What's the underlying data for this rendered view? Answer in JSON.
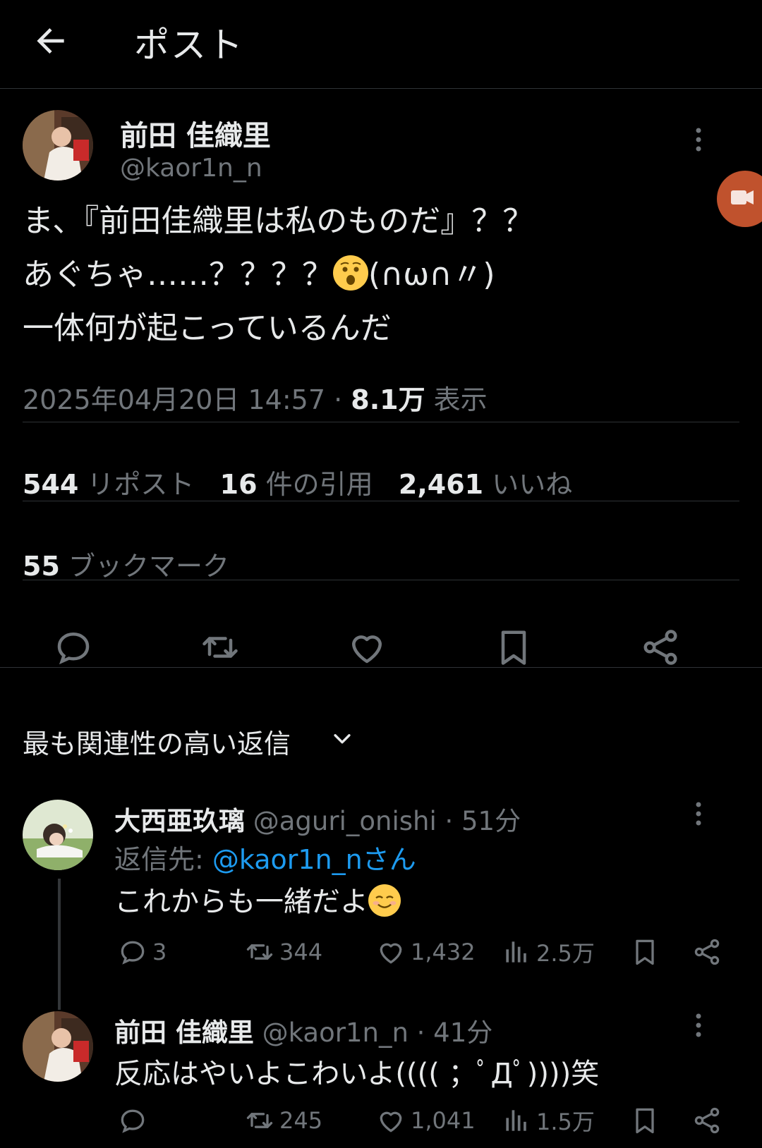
{
  "header": {
    "title": "ポスト",
    "back_icon": "arrow-left-icon"
  },
  "post": {
    "author_name": "前田 佳織里",
    "author_handle": "@kaor1n_n",
    "lines": [
      "ま、『前田佳織里は私のものだ』？？",
      "あぐちゃ……？？？？",
      "(∩ω∩〃)",
      "一体何が起こっているんだ"
    ],
    "timestamp": "2025年04月20日 14:57 · ",
    "views_value": "8.1万",
    "views_label": " 表示",
    "reposts_value": "544",
    "reposts_label": " リポスト",
    "quotes_value": "16",
    "quotes_label": " 件の引用",
    "likes_value": "2,461",
    "likes_label": " いいね",
    "bookmarks_value": "55",
    "bookmarks_label": " ブックマーク"
  },
  "replies_sort": {
    "label": "最も関連性の高い返信"
  },
  "replies": [
    {
      "author_name": "大西亜玖璃",
      "author_handle": " @aguri_onishi · 51分",
      "reply_to_label": "返信先: ",
      "reply_to_link": "@kaor1n_nさん",
      "text": "これからも一緒だよ",
      "replies": "3",
      "reposts": "344",
      "likes": "1,432",
      "views": "2.5万"
    },
    {
      "author_name": "前田 佳織里",
      "author_handle": " @kaor1n_n · 41分",
      "text": "反応はやいよこわいよ(((( ；ﾟДﾟ))))笑",
      "reposts": "245",
      "likes": "1,041",
      "views": "1.5万"
    }
  ],
  "colors": {
    "background": "#000000",
    "text": "#e7e9ea",
    "muted": "#71767b",
    "link": "#1d9bf0",
    "divider": "#2f3336"
  }
}
